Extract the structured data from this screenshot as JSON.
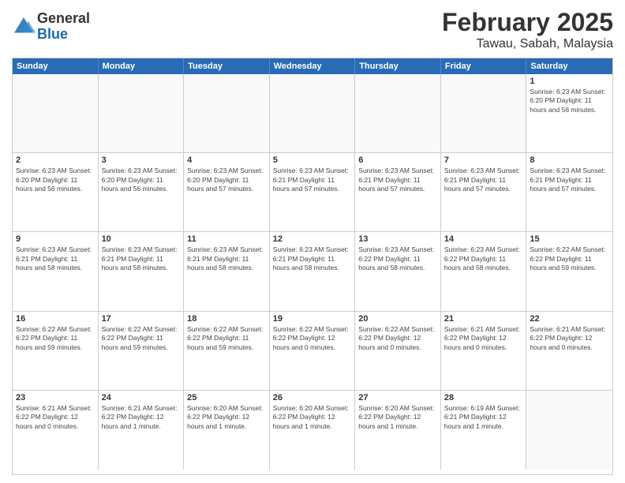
{
  "logo": {
    "general": "General",
    "blue": "Blue"
  },
  "header": {
    "month": "February 2025",
    "location": "Tawau, Sabah, Malaysia"
  },
  "days_of_week": [
    "Sunday",
    "Monday",
    "Tuesday",
    "Wednesday",
    "Thursday",
    "Friday",
    "Saturday"
  ],
  "weeks": [
    [
      {
        "day": "",
        "info": ""
      },
      {
        "day": "",
        "info": ""
      },
      {
        "day": "",
        "info": ""
      },
      {
        "day": "",
        "info": ""
      },
      {
        "day": "",
        "info": ""
      },
      {
        "day": "",
        "info": ""
      },
      {
        "day": "1",
        "info": "Sunrise: 6:23 AM\nSunset: 6:20 PM\nDaylight: 11 hours and 56 minutes."
      }
    ],
    [
      {
        "day": "2",
        "info": "Sunrise: 6:23 AM\nSunset: 6:20 PM\nDaylight: 11 hours and 56 minutes."
      },
      {
        "day": "3",
        "info": "Sunrise: 6:23 AM\nSunset: 6:20 PM\nDaylight: 11 hours and 56 minutes."
      },
      {
        "day": "4",
        "info": "Sunrise: 6:23 AM\nSunset: 6:20 PM\nDaylight: 11 hours and 57 minutes."
      },
      {
        "day": "5",
        "info": "Sunrise: 6:23 AM\nSunset: 6:21 PM\nDaylight: 11 hours and 57 minutes."
      },
      {
        "day": "6",
        "info": "Sunrise: 6:23 AM\nSunset: 6:21 PM\nDaylight: 11 hours and 57 minutes."
      },
      {
        "day": "7",
        "info": "Sunrise: 6:23 AM\nSunset: 6:21 PM\nDaylight: 11 hours and 57 minutes."
      },
      {
        "day": "8",
        "info": "Sunrise: 6:23 AM\nSunset: 6:21 PM\nDaylight: 11 hours and 57 minutes."
      }
    ],
    [
      {
        "day": "9",
        "info": "Sunrise: 6:23 AM\nSunset: 6:21 PM\nDaylight: 11 hours and 58 minutes."
      },
      {
        "day": "10",
        "info": "Sunrise: 6:23 AM\nSunset: 6:21 PM\nDaylight: 11 hours and 58 minutes."
      },
      {
        "day": "11",
        "info": "Sunrise: 6:23 AM\nSunset: 6:21 PM\nDaylight: 11 hours and 58 minutes."
      },
      {
        "day": "12",
        "info": "Sunrise: 6:23 AM\nSunset: 6:21 PM\nDaylight: 11 hours and 58 minutes."
      },
      {
        "day": "13",
        "info": "Sunrise: 6:23 AM\nSunset: 6:22 PM\nDaylight: 11 hours and 58 minutes."
      },
      {
        "day": "14",
        "info": "Sunrise: 6:23 AM\nSunset: 6:22 PM\nDaylight: 11 hours and 58 minutes."
      },
      {
        "day": "15",
        "info": "Sunrise: 6:22 AM\nSunset: 6:22 PM\nDaylight: 11 hours and 59 minutes."
      }
    ],
    [
      {
        "day": "16",
        "info": "Sunrise: 6:22 AM\nSunset: 6:22 PM\nDaylight: 11 hours and 59 minutes."
      },
      {
        "day": "17",
        "info": "Sunrise: 6:22 AM\nSunset: 6:22 PM\nDaylight: 11 hours and 59 minutes."
      },
      {
        "day": "18",
        "info": "Sunrise: 6:22 AM\nSunset: 6:22 PM\nDaylight: 11 hours and 59 minutes."
      },
      {
        "day": "19",
        "info": "Sunrise: 6:22 AM\nSunset: 6:22 PM\nDaylight: 12 hours and 0 minutes."
      },
      {
        "day": "20",
        "info": "Sunrise: 6:22 AM\nSunset: 6:22 PM\nDaylight: 12 hours and 0 minutes."
      },
      {
        "day": "21",
        "info": "Sunrise: 6:21 AM\nSunset: 6:22 PM\nDaylight: 12 hours and 0 minutes."
      },
      {
        "day": "22",
        "info": "Sunrise: 6:21 AM\nSunset: 6:22 PM\nDaylight: 12 hours and 0 minutes."
      }
    ],
    [
      {
        "day": "23",
        "info": "Sunrise: 6:21 AM\nSunset: 6:22 PM\nDaylight: 12 hours and 0 minutes."
      },
      {
        "day": "24",
        "info": "Sunrise: 6:21 AM\nSunset: 6:22 PM\nDaylight: 12 hours and 1 minute."
      },
      {
        "day": "25",
        "info": "Sunrise: 6:20 AM\nSunset: 6:22 PM\nDaylight: 12 hours and 1 minute."
      },
      {
        "day": "26",
        "info": "Sunrise: 6:20 AM\nSunset: 6:22 PM\nDaylight: 12 hours and 1 minute."
      },
      {
        "day": "27",
        "info": "Sunrise: 6:20 AM\nSunset: 6:22 PM\nDaylight: 12 hours and 1 minute."
      },
      {
        "day": "28",
        "info": "Sunrise: 6:19 AM\nSunset: 6:21 PM\nDaylight: 12 hours and 1 minute."
      },
      {
        "day": "",
        "info": ""
      }
    ]
  ]
}
